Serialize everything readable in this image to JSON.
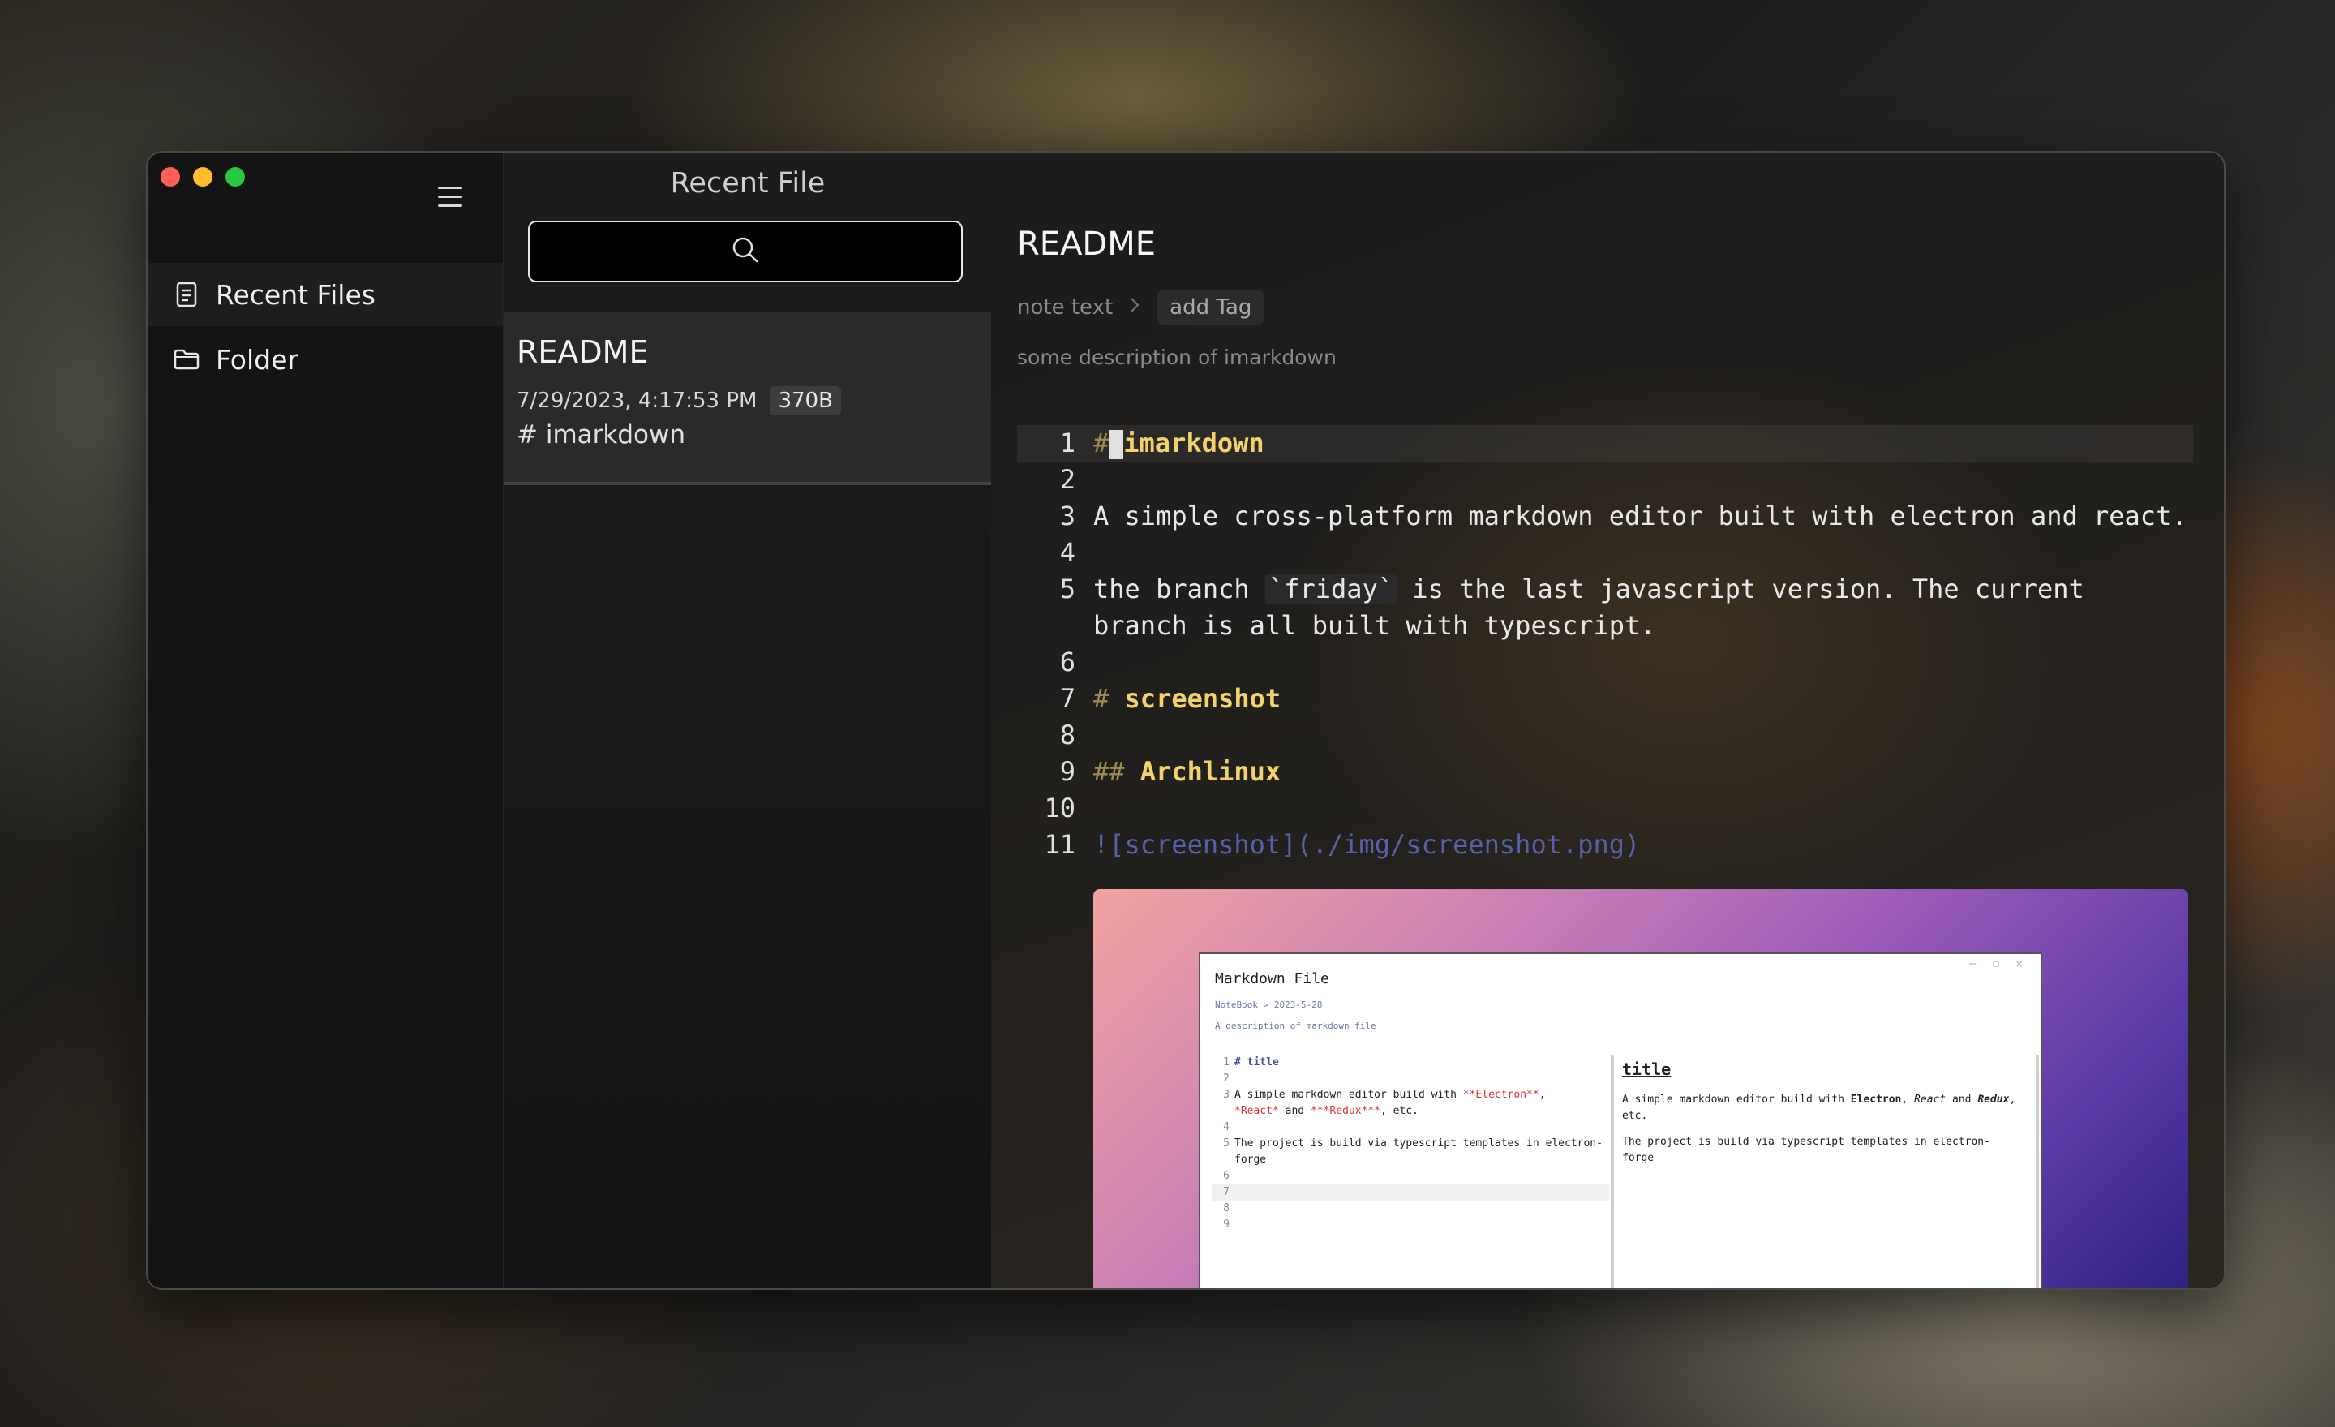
{
  "sidebar": {
    "items": [
      {
        "label": "Recent Files",
        "icon": "document-icon"
      },
      {
        "label": "Folder",
        "icon": "folder-icon"
      }
    ]
  },
  "list_panel": {
    "title": "Recent File",
    "files": [
      {
        "title": "README",
        "date": "7/29/2023, 4:17:53 PM",
        "size": "370B",
        "preview": "# imarkdown"
      }
    ]
  },
  "document": {
    "title": "README",
    "breadcrumb": "note text",
    "add_tag_label": "add Tag",
    "description": "some description of imarkdown",
    "lines": [
      {
        "n": "1",
        "mark": "#",
        "text": "imarkdown"
      },
      {
        "n": "2",
        "text": ""
      },
      {
        "n": "3",
        "text": "A simple cross-platform markdown editor built with electron and react."
      },
      {
        "n": "4",
        "text": ""
      },
      {
        "n": "5",
        "text_a": "the branch ",
        "code": "`friday`",
        "text_b": " is the last javascript version. The current branch is all built with typescript."
      },
      {
        "n": "6",
        "text": ""
      },
      {
        "n": "7",
        "mark": "#",
        "text": "screenshot"
      },
      {
        "n": "8",
        "text": ""
      },
      {
        "n": "9",
        "mark": "##",
        "text": "Archlinux"
      },
      {
        "n": "10",
        "text": ""
      },
      {
        "n": "11",
        "text": "![screenshot](./img/screenshot.png)"
      }
    ]
  },
  "embedded_screenshot": {
    "window_title": "Markdown File",
    "breadcrumb": "NoteBook > 2023-5-28",
    "description": "A description of markdown file",
    "editor_lines": [
      {
        "n": "1",
        "mark": "#",
        "text": "title"
      },
      {
        "n": "2",
        "text": ""
      },
      {
        "n": "3",
        "a": "A simple markdown editor build with ",
        "b": "**Electron**",
        "c": ","
      },
      {
        "n": "",
        "a": "",
        "b": "*React*",
        "c": " and ",
        "d": "***Redux***",
        "e": ", etc."
      },
      {
        "n": "4",
        "text": ""
      },
      {
        "n": "5",
        "text": "The project is build via typescript templates in electron-forge"
      },
      {
        "n": "6",
        "text": ""
      },
      {
        "n": "7",
        "text": ""
      },
      {
        "n": "8",
        "text": ""
      },
      {
        "n": "9",
        "text": ""
      }
    ],
    "preview_heading": "title",
    "preview_p1_a": "A simple markdown editor build with ",
    "preview_p1_b": "Electron",
    "preview_p1_c": ", ",
    "preview_p1_d": "React",
    "preview_p1_e": " and ",
    "preview_p1_f": "Redux",
    "preview_p1_g": ", etc.",
    "preview_p2": "The project is build via typescript templates in electron-forge"
  },
  "colors": {
    "heading": "#f2d36b",
    "heading_mark": "#9f8b55",
    "link": "#5860a8",
    "traffic_red": "#fe5f57",
    "traffic_yellow": "#febc2e",
    "traffic_green": "#28c840"
  }
}
